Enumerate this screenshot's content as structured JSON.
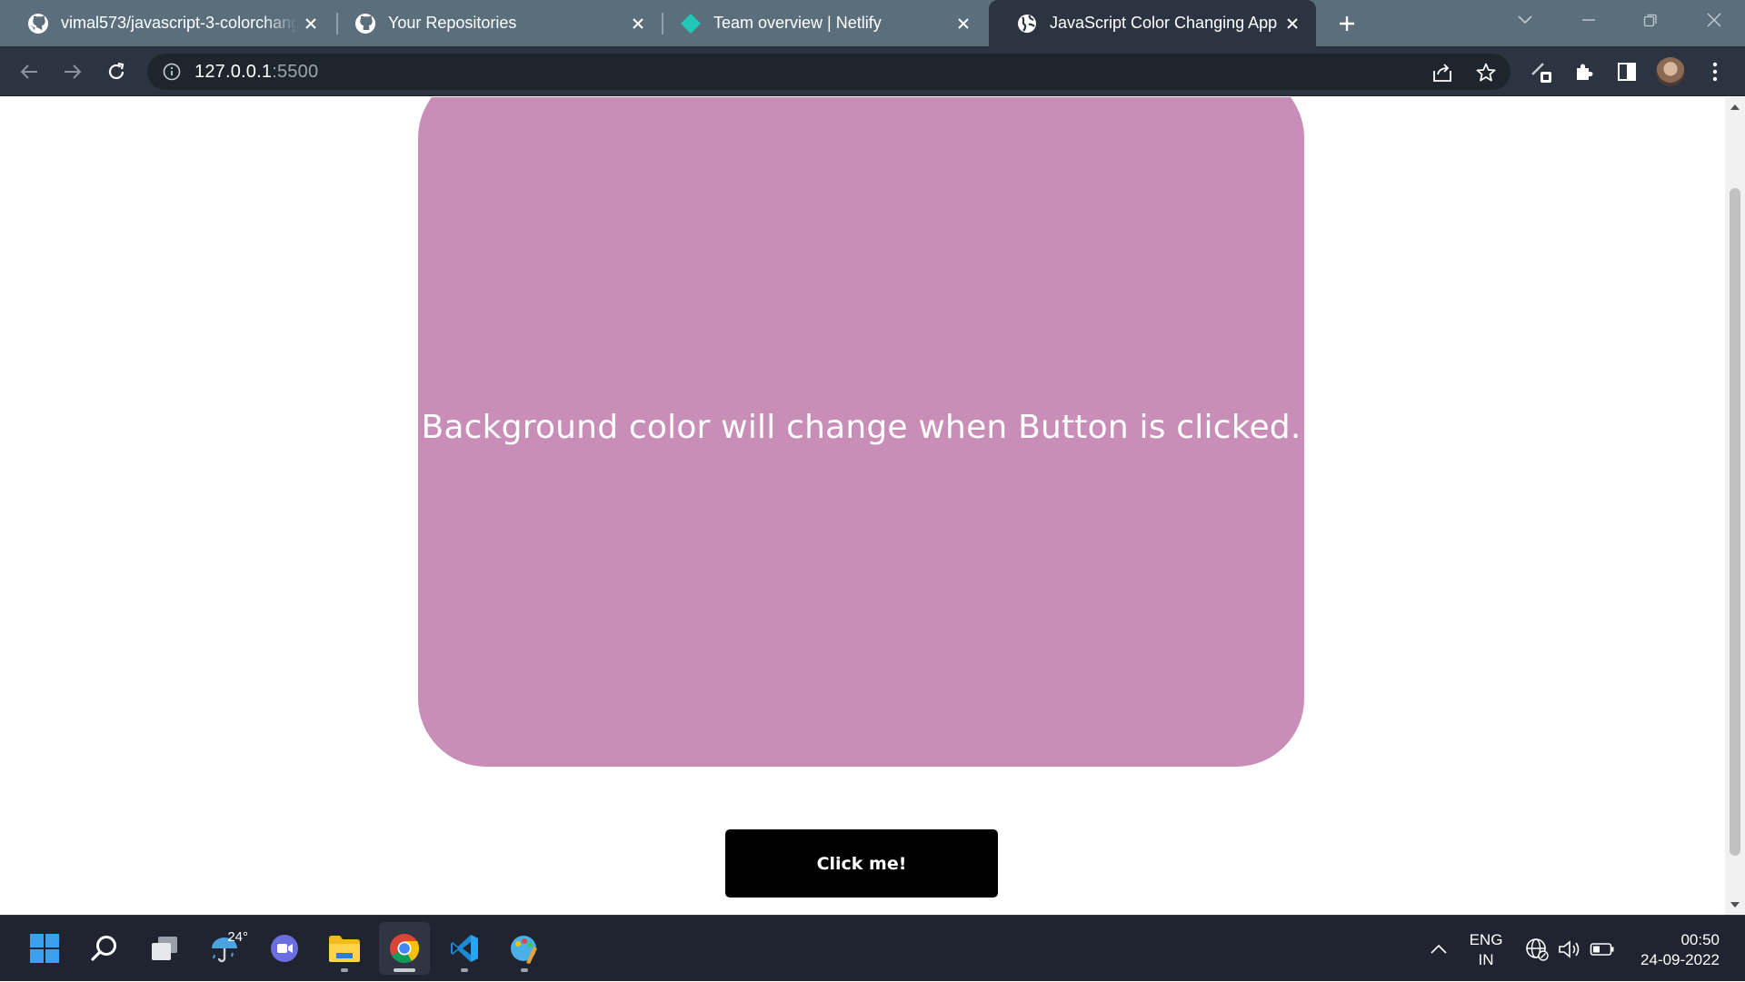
{
  "browser": {
    "tabs": [
      {
        "title": "vimal573/javascript-3-colorchanging-app",
        "icon": "github-icon"
      },
      {
        "title": "Your Repositories",
        "icon": "github-icon"
      },
      {
        "title": "Team overview | Netlify",
        "icon": "netlify-icon"
      },
      {
        "title": "JavaScript Color Changing App",
        "icon": "globe-icon",
        "active": true
      }
    ],
    "address": {
      "host": "127.0.0.1",
      "port": ":5500"
    }
  },
  "page": {
    "message": "Background color will change when Button is clicked.",
    "button_label": "Click me!",
    "box_color": "#c98eb8"
  },
  "taskbar": {
    "weather_temp": "24°",
    "language": {
      "line1": "ENG",
      "line2": "IN"
    },
    "clock": {
      "time": "00:50",
      "date": "24-09-2022"
    }
  }
}
